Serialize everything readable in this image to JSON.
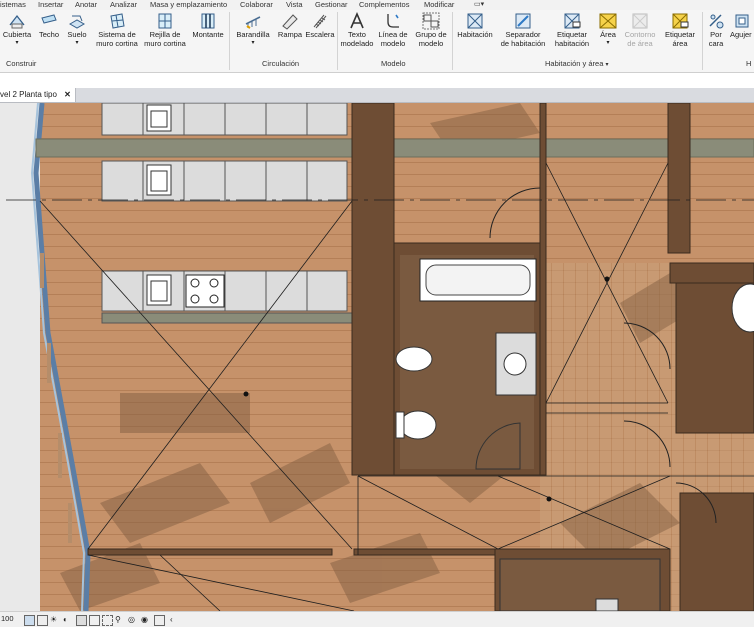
{
  "menu": {
    "items": [
      "istemas",
      "Insertar",
      "Anotar",
      "Analizar",
      "Masa y emplazamiento",
      "Colaborar",
      "Vista",
      "Gestionar",
      "Complementos",
      "Modificar"
    ]
  },
  "ribbon": {
    "construir": {
      "title": "Construir",
      "tools": [
        {
          "line1": "Cubierta",
          "line2": "",
          "icon": "roof-icon"
        },
        {
          "line1": "Techo",
          "line2": "",
          "icon": "ceiling-icon"
        },
        {
          "line1": "Suelo",
          "line2": "",
          "icon": "floor-icon"
        },
        {
          "line1": "Sistema de",
          "line2": "muro cortina",
          "icon": "curtain-system-icon"
        },
        {
          "line1": "Rejilla de",
          "line2": "muro cortina",
          "icon": "curtain-grid-icon"
        },
        {
          "line1": "Montante",
          "line2": "",
          "icon": "mullion-icon"
        }
      ]
    },
    "circulacion": {
      "title": "Circulación",
      "tools": [
        {
          "line1": "Barandilla",
          "line2": "",
          "icon": "railing-icon"
        },
        {
          "line1": "Rampa",
          "line2": "",
          "icon": "ramp-icon"
        },
        {
          "line1": "Escalera",
          "line2": "",
          "icon": "stair-icon"
        }
      ]
    },
    "modelo": {
      "title": "Modelo",
      "tools": [
        {
          "line1": "Texto",
          "line2": "modelado",
          "icon": "model-text-icon"
        },
        {
          "line1": "Línea de",
          "line2": "modelo",
          "icon": "model-line-icon"
        },
        {
          "line1": "Grupo de",
          "line2": "modelo",
          "icon": "model-group-icon"
        }
      ]
    },
    "habitacion": {
      "title": "Habitación y área",
      "tools": [
        {
          "line1": "Habitación",
          "line2": "",
          "icon": "room-icon"
        },
        {
          "line1": "Separador",
          "line2": "de habitación",
          "icon": "room-separator-icon"
        },
        {
          "line1": "Etiquetar",
          "line2": "habitación",
          "icon": "tag-room-icon"
        },
        {
          "line1": "Área",
          "line2": "",
          "icon": "area-icon"
        },
        {
          "line1": "Contorno",
          "line2": "de área",
          "icon": "area-boundary-icon"
        },
        {
          "line1": "Etiquetar",
          "line2": "área",
          "icon": "tag-area-icon"
        }
      ]
    },
    "hueco": {
      "title": "H",
      "tools": [
        {
          "line1": "Por",
          "line2": "cara",
          "icon": "by-face-icon"
        },
        {
          "line1": "Agujer",
          "line2": "",
          "icon": "shaft-icon"
        }
      ]
    }
  },
  "view_tab": {
    "label": "vel 2 Planta tipo",
    "close": "✕"
  },
  "status": {
    "zoom": "100"
  },
  "colors": {
    "floor_wood": "#c6926a",
    "wall_dark": "#6e4d34",
    "counter_stone": "#8a8c79",
    "selection_lines": "#1e1e1e",
    "ribbon_bg": "#f5f5f5"
  }
}
